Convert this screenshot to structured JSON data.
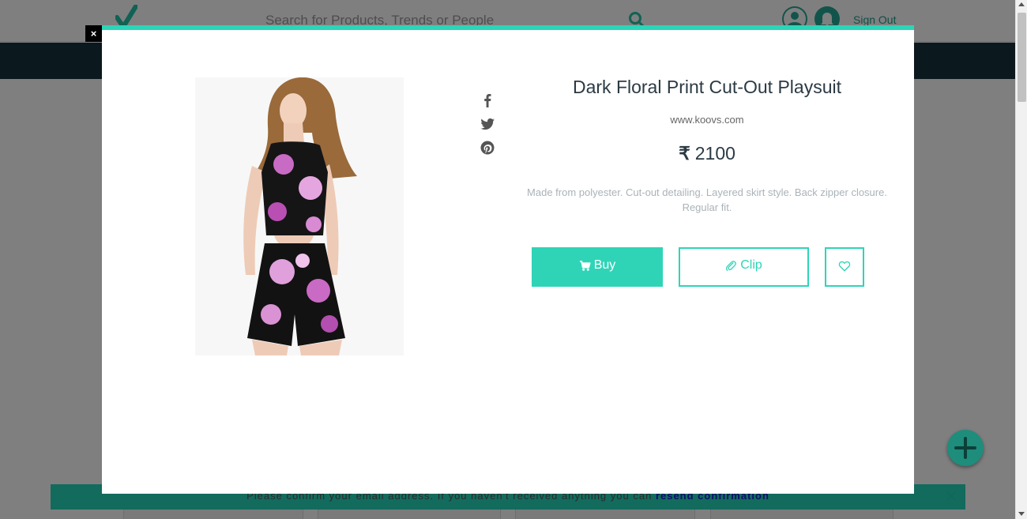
{
  "header": {
    "search_placeholder": "Search for Products, Trends or People",
    "sign_out_label": "Sign Out"
  },
  "product": {
    "title": "Dark Floral Print Cut-Out Playsuit",
    "store": "www.koovs.com",
    "currency_symbol": "₹",
    "price": "2100",
    "description": "Made from polyester. Cut-out detailing. Layered skirt style. Back zipper closure. Regular fit.",
    "buy_label": "Buy",
    "clip_label": "Clip"
  },
  "modal": {
    "close_label": "×"
  },
  "banner": {
    "message": "Please confirm your email address. If you haven't received anything you can ",
    "link_label": "resend confirmation"
  },
  "icons": {
    "share": [
      "facebook-icon",
      "twitter-icon",
      "pinterest-icon"
    ],
    "actions": [
      "cart-icon",
      "paperclip-icon",
      "heart-icon"
    ]
  },
  "colors": {
    "accent": "#2fd4b7",
    "nav_dark": "#16303a",
    "title_text": "#2b3a44",
    "description_text": "#aab3b8",
    "banner_link": "#1a1ad8"
  }
}
